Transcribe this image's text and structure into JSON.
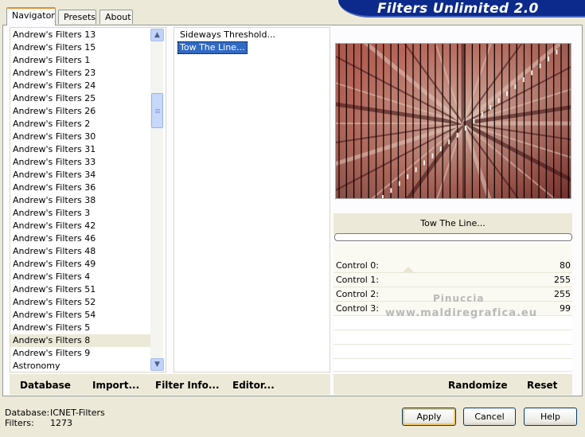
{
  "tabs": [
    {
      "label": "Navigator"
    },
    {
      "label": "Presets"
    },
    {
      "label": "About"
    }
  ],
  "banner": {
    "title": "Filters Unlimited 2.0"
  },
  "categories": [
    "Andrew's Filters 13",
    "Andrew's Filters 15",
    "Andrew's Filters 1",
    "Andrew's Filters 23",
    "Andrew's Filters 24",
    "Andrew's Filters 25",
    "Andrew's Filters 26",
    "Andrew's Filters 2",
    "Andrew's Filters 30",
    "Andrew's Filters 31",
    "Andrew's Filters 33",
    "Andrew's Filters 34",
    "Andrew's Filters 36",
    "Andrew's Filters 38",
    "Andrew's Filters 3",
    "Andrew's Filters 42",
    "Andrew's Filters 46",
    "Andrew's Filters 48",
    "Andrew's Filters 49",
    "Andrew's Filters 4",
    "Andrew's Filters 51",
    "Andrew's Filters 52",
    "Andrew's Filters 54",
    "Andrew's Filters 5",
    "Andrew's Filters 8",
    "Andrew's Filters 9",
    "Astronomy"
  ],
  "selected_category": "Andrew's Filters 8",
  "filters": [
    "Sideways Threshold...",
    "Tow The Line..."
  ],
  "selected_filter": "Tow The Line...",
  "preview": {
    "filter_name": "Tow The Line..."
  },
  "controls": [
    {
      "label": "Control 0:",
      "value": "80"
    },
    {
      "label": "Control 1:",
      "value": "255"
    },
    {
      "label": "Control 2:",
      "value": "255"
    },
    {
      "label": "Control 3:",
      "value": "99"
    }
  ],
  "watermark": {
    "line1": "Pinuccia",
    "line2": "www.maldiregrafica.eu"
  },
  "left_buttons": {
    "database": "Database",
    "import": "Import...",
    "filter_info": "Filter Info...",
    "editor": "Editor..."
  },
  "right_buttons": {
    "randomize": "Randomize",
    "reset": "Reset"
  },
  "status": {
    "database_label": "Database:",
    "database_value": "ICNET-Filters",
    "filters_label": "Filters:",
    "filters_value": "1273"
  },
  "dialog_buttons": {
    "apply": "Apply",
    "cancel": "Cancel",
    "help": "Help"
  },
  "colors": {
    "selection": "#316ac5",
    "banner": "#0c2a8c",
    "tab_accent": "#e68b2c"
  }
}
